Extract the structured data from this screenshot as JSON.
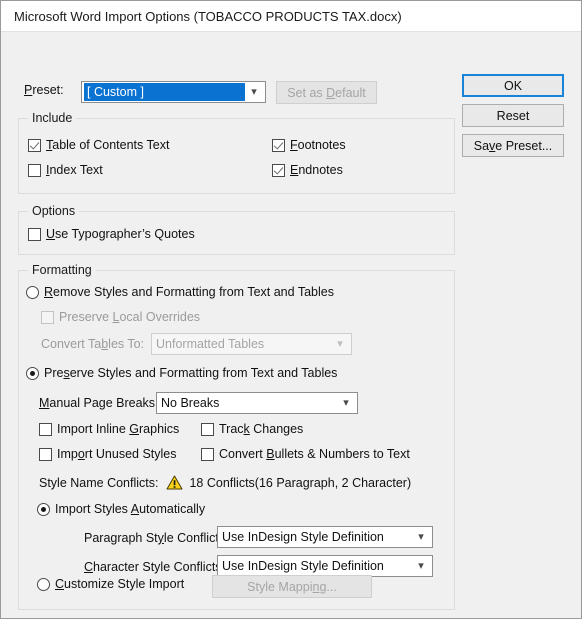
{
  "window": {
    "title": "Microsoft Word Import Options (TOBACCO PRODUCTS TAX.docx)"
  },
  "preset": {
    "label": "Preset:",
    "value": "[ Custom ]",
    "set_as_default_label": "Set as Default",
    "set_as_default_enabled": "false"
  },
  "buttons": {
    "ok": "OK",
    "reset": "Reset",
    "save_preset": "Save Preset..."
  },
  "include": {
    "legend": "Include",
    "items": [
      {
        "label": "Table of Contents Text",
        "checked": "true"
      },
      {
        "label": "Index Text",
        "checked": "false"
      },
      {
        "label": "Footnotes",
        "checked": "true"
      },
      {
        "label": "Endnotes",
        "checked": "true"
      }
    ]
  },
  "options": {
    "legend": "Options",
    "typographers_quotes": {
      "label": "Use Typographer's Quotes",
      "checked": "false"
    }
  },
  "formatting": {
    "legend": "Formatting",
    "remove_styles": {
      "label": "Remove Styles and Formatting from Text and Tables",
      "selected": "false"
    },
    "preserve_local_overrides": {
      "label": "Preserve Local Overrides",
      "checked": "false",
      "enabled": "false"
    },
    "convert_tables": {
      "label": "Convert Tables To:",
      "value": "Unformatted Tables",
      "enabled": "false"
    },
    "preserve_styles": {
      "label": "Preserve Styles and Formatting from Text and Tables",
      "selected": "true"
    },
    "manual_page_breaks": {
      "label": "Manual Page Breaks:",
      "value": "No Breaks"
    },
    "checkboxes": [
      {
        "label": "Import Inline Graphics",
        "checked": "false"
      },
      {
        "label": "Track Changes",
        "checked": "false"
      },
      {
        "label": "Import Unused Styles",
        "checked": "false"
      },
      {
        "label": "Convert Bullets & Numbers to Text",
        "checked": "false"
      }
    ],
    "style_name_conflicts": {
      "label": "Style Name Conflicts:",
      "icon": "warning-triangle-icon",
      "value": "18 Conflicts(16 Paragraph, 2 Character)"
    },
    "import_styles_automatically": {
      "label": "Import Styles Automatically",
      "selected": "true"
    },
    "paragraph_style_conflicts": {
      "label": "Paragraph Style Conflicts:",
      "value": "Use InDesign Style Definition"
    },
    "character_style_conflicts": {
      "label": "Character Style Conflicts:",
      "value": "Use InDesign Style Definition"
    },
    "customize_style_import": {
      "label": "Customize Style Import",
      "selected": "false"
    },
    "style_mapping_button": {
      "label": "Style Mapping...",
      "enabled": "false"
    }
  },
  "colors": {
    "accent": "#0a72d1",
    "focus": "#1884d8",
    "warning": "#f7d117",
    "window_bg": "#f0f0f0"
  }
}
